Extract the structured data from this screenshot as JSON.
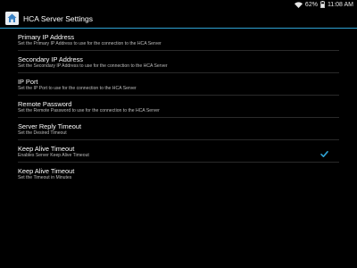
{
  "status_bar": {
    "battery_percent": "62%",
    "time": "11:08 AM",
    "icons": [
      "wifi-icon",
      "battery-icon"
    ]
  },
  "action_bar": {
    "title": "HCA Server Settings",
    "icon": "house-app-icon"
  },
  "colors": {
    "accent": "#2fa3d4",
    "background": "#000000",
    "divider": "#2a2a2a",
    "summary_text": "#bdbdbd"
  },
  "preferences": [
    {
      "title": "Primary IP Address",
      "summary": "Set the Primary IP Address to use for the connection to the HCA Server"
    },
    {
      "title": "Secondary IP Address",
      "summary": "Set the Secondary IP Address to use for the connection to the HCA Server"
    },
    {
      "title": "IP Port",
      "summary": "Set the IP Port to use for the connection to the HCA Server"
    },
    {
      "title": "Remote Password",
      "summary": "Set the Remote Password to use for the connection to the HCA Server"
    },
    {
      "title": "Server Reply Timeout",
      "summary": "Set the Desired Timeout"
    },
    {
      "title": "Keep Alive Timeout",
      "summary": "Enables Server Keep Alive Timeout",
      "checked": true
    },
    {
      "title": "Keep Alive Timeout",
      "summary": "Set the Timeout in Minutes"
    }
  ]
}
